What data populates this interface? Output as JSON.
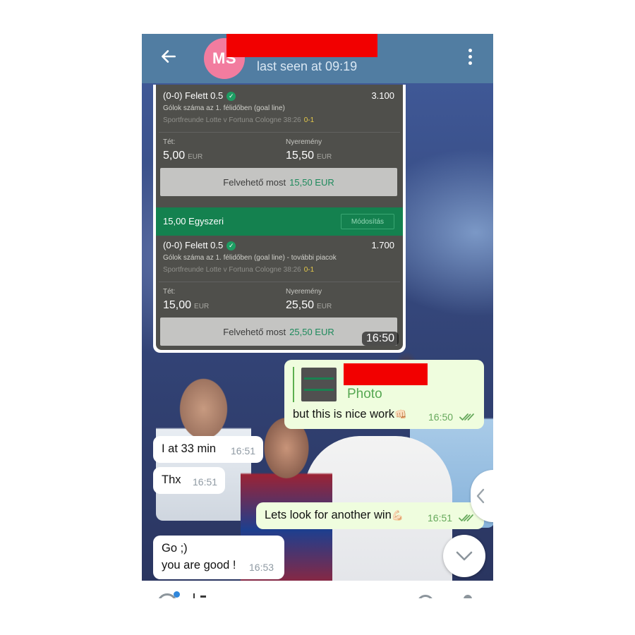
{
  "colors": {
    "header": "#517da2",
    "avatar": "#f27c9f",
    "redaction": "#f20000",
    "outgoing_bubble": "#effdde",
    "incoming_bubble": "#ffffff",
    "slip_bg": "#4f4f4b",
    "slip_green": "#14814f"
  },
  "header": {
    "back_icon": "arrow-left-icon",
    "avatar_initials": "MS",
    "status": "last seen at 09:19",
    "menu_icon": "more-vertical-icon"
  },
  "image_message": {
    "time": "16:50",
    "bet1": {
      "pick": "(0-0) Felett 0.5",
      "odds": "3.100",
      "market": "Gólok száma az 1. félidőben (goal line)",
      "match": "Sportfreunde Lotte v Fortuna Cologne  38:26",
      "score": "0-1",
      "stake_label": "Tét:",
      "stake_value": "5,00",
      "stake_currency": "EUR",
      "win_label": "Nyeremény",
      "win_value": "15,50",
      "win_currency": "EUR",
      "cashout_label": "Felvehető most",
      "cashout_value": "15,50 EUR"
    },
    "bet2_header": {
      "title": "15,00  Egyszeri",
      "button": "Módosítás"
    },
    "bet2": {
      "pick": "(0-0) Felett 0.5",
      "odds": "1.700",
      "market": "Gólok száma az 1. félidőben (goal line) - további piacok",
      "match": "Sportfreunde Lotte v Fortuna Cologne  38:26",
      "score": "0-1",
      "stake_label": "Tét:",
      "stake_value": "15,00",
      "stake_currency": "EUR",
      "win_label": "Nyeremény",
      "win_value": "25,50",
      "win_currency": "EUR",
      "cashout_label": "Felvehető most",
      "cashout_value": "25,50 EUR"
    }
  },
  "messages": [
    {
      "direction": "out",
      "reply_label": "Photo",
      "text": "but this is nice work",
      "emoji": "👊🏻",
      "time": "16:50"
    },
    {
      "direction": "in",
      "text": "I at 33 min",
      "time": "16:51"
    },
    {
      "direction": "in",
      "text": "Thx",
      "time": "16:51"
    },
    {
      "direction": "out",
      "text": "Lets look for another win",
      "emoji": "💪🏻",
      "time": "16:51"
    },
    {
      "direction": "in",
      "text_line1": "Go ;)",
      "text_line2": "you are good !",
      "time": "16:53"
    }
  ],
  "floating": {
    "side_icon": "chevron-left-icon",
    "scroll_icon": "chevron-down-icon"
  },
  "input_bar": {
    "emoji_icon": "emoji-icon",
    "attach_icon": "attach-icon",
    "mic_icon": "mic-icon"
  }
}
